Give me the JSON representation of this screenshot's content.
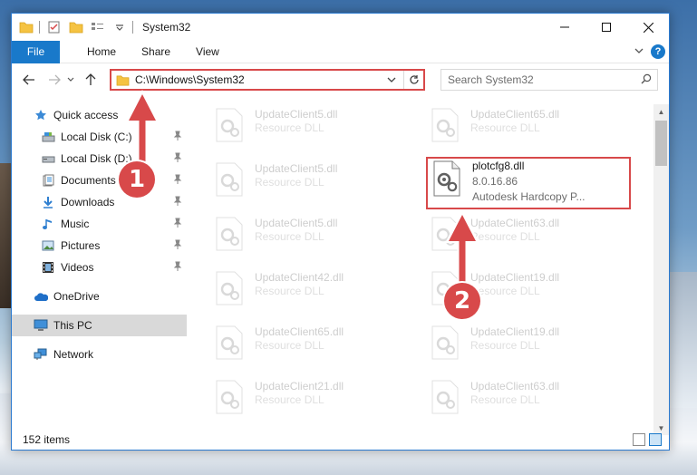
{
  "window": {
    "title": "System32"
  },
  "ribbon": {
    "tabs": [
      "File",
      "Home",
      "Share",
      "View"
    ],
    "help": "?"
  },
  "navbar": {
    "address": "C:\\Windows\\System32",
    "search_placeholder": "Search System32"
  },
  "sidebar": {
    "items": [
      {
        "label": "Quick access",
        "icon": "star-icon",
        "pinned": false
      },
      {
        "label": "Local Disk (C:)",
        "icon": "drive-icon",
        "pinned": true
      },
      {
        "label": "Local Disk (D:)",
        "icon": "drive-icon",
        "pinned": true
      },
      {
        "label": "Documents",
        "icon": "documents-icon",
        "pinned": true
      },
      {
        "label": "Downloads",
        "icon": "download-icon",
        "pinned": true
      },
      {
        "label": "Music",
        "icon": "music-icon",
        "pinned": true
      },
      {
        "label": "Pictures",
        "icon": "pictures-icon",
        "pinned": true
      },
      {
        "label": "Videos",
        "icon": "videos-icon",
        "pinned": true
      },
      {
        "label": "OneDrive",
        "icon": "cloud-icon",
        "pinned": false
      },
      {
        "label": "This PC",
        "icon": "computer-icon",
        "pinned": false,
        "selected": true
      },
      {
        "label": "Network",
        "icon": "network-icon",
        "pinned": false
      }
    ]
  },
  "files": {
    "left": [
      {
        "name": "UpdateClient5.dll",
        "type": "Resource DLL"
      },
      {
        "name": "UpdateClient5.dll",
        "type": "Resource DLL"
      },
      {
        "name": "UpdateClient5.dll",
        "type": "Resource DLL"
      },
      {
        "name": "UpdateClient42.dll",
        "type": "Resource DLL"
      },
      {
        "name": "UpdateClient65.dll",
        "type": "Resource DLL"
      },
      {
        "name": "UpdateClient21.dll",
        "type": "Resource DLL"
      }
    ],
    "right": [
      {
        "name": "UpdateClient65.dll",
        "type": "Resource DLL"
      },
      {
        "name": "UpdateClient63.dll",
        "type": "Resource DLL"
      },
      {
        "name": "UpdateClient19.dll",
        "type": "Resource DLL"
      },
      {
        "name": "UpdateClient19.dll",
        "type": "Resource DLL"
      },
      {
        "name": "UpdateClient63.dll",
        "type": "Resource DLL"
      }
    ],
    "highlighted": {
      "name": "plotcfg8.dll",
      "version": "8.0.16.86",
      "description": "Autodesk Hardcopy P..."
    }
  },
  "status": {
    "item_count": "152 items"
  },
  "annotations": {
    "step1": "1",
    "step2": "2",
    "color": "#d8494a"
  }
}
